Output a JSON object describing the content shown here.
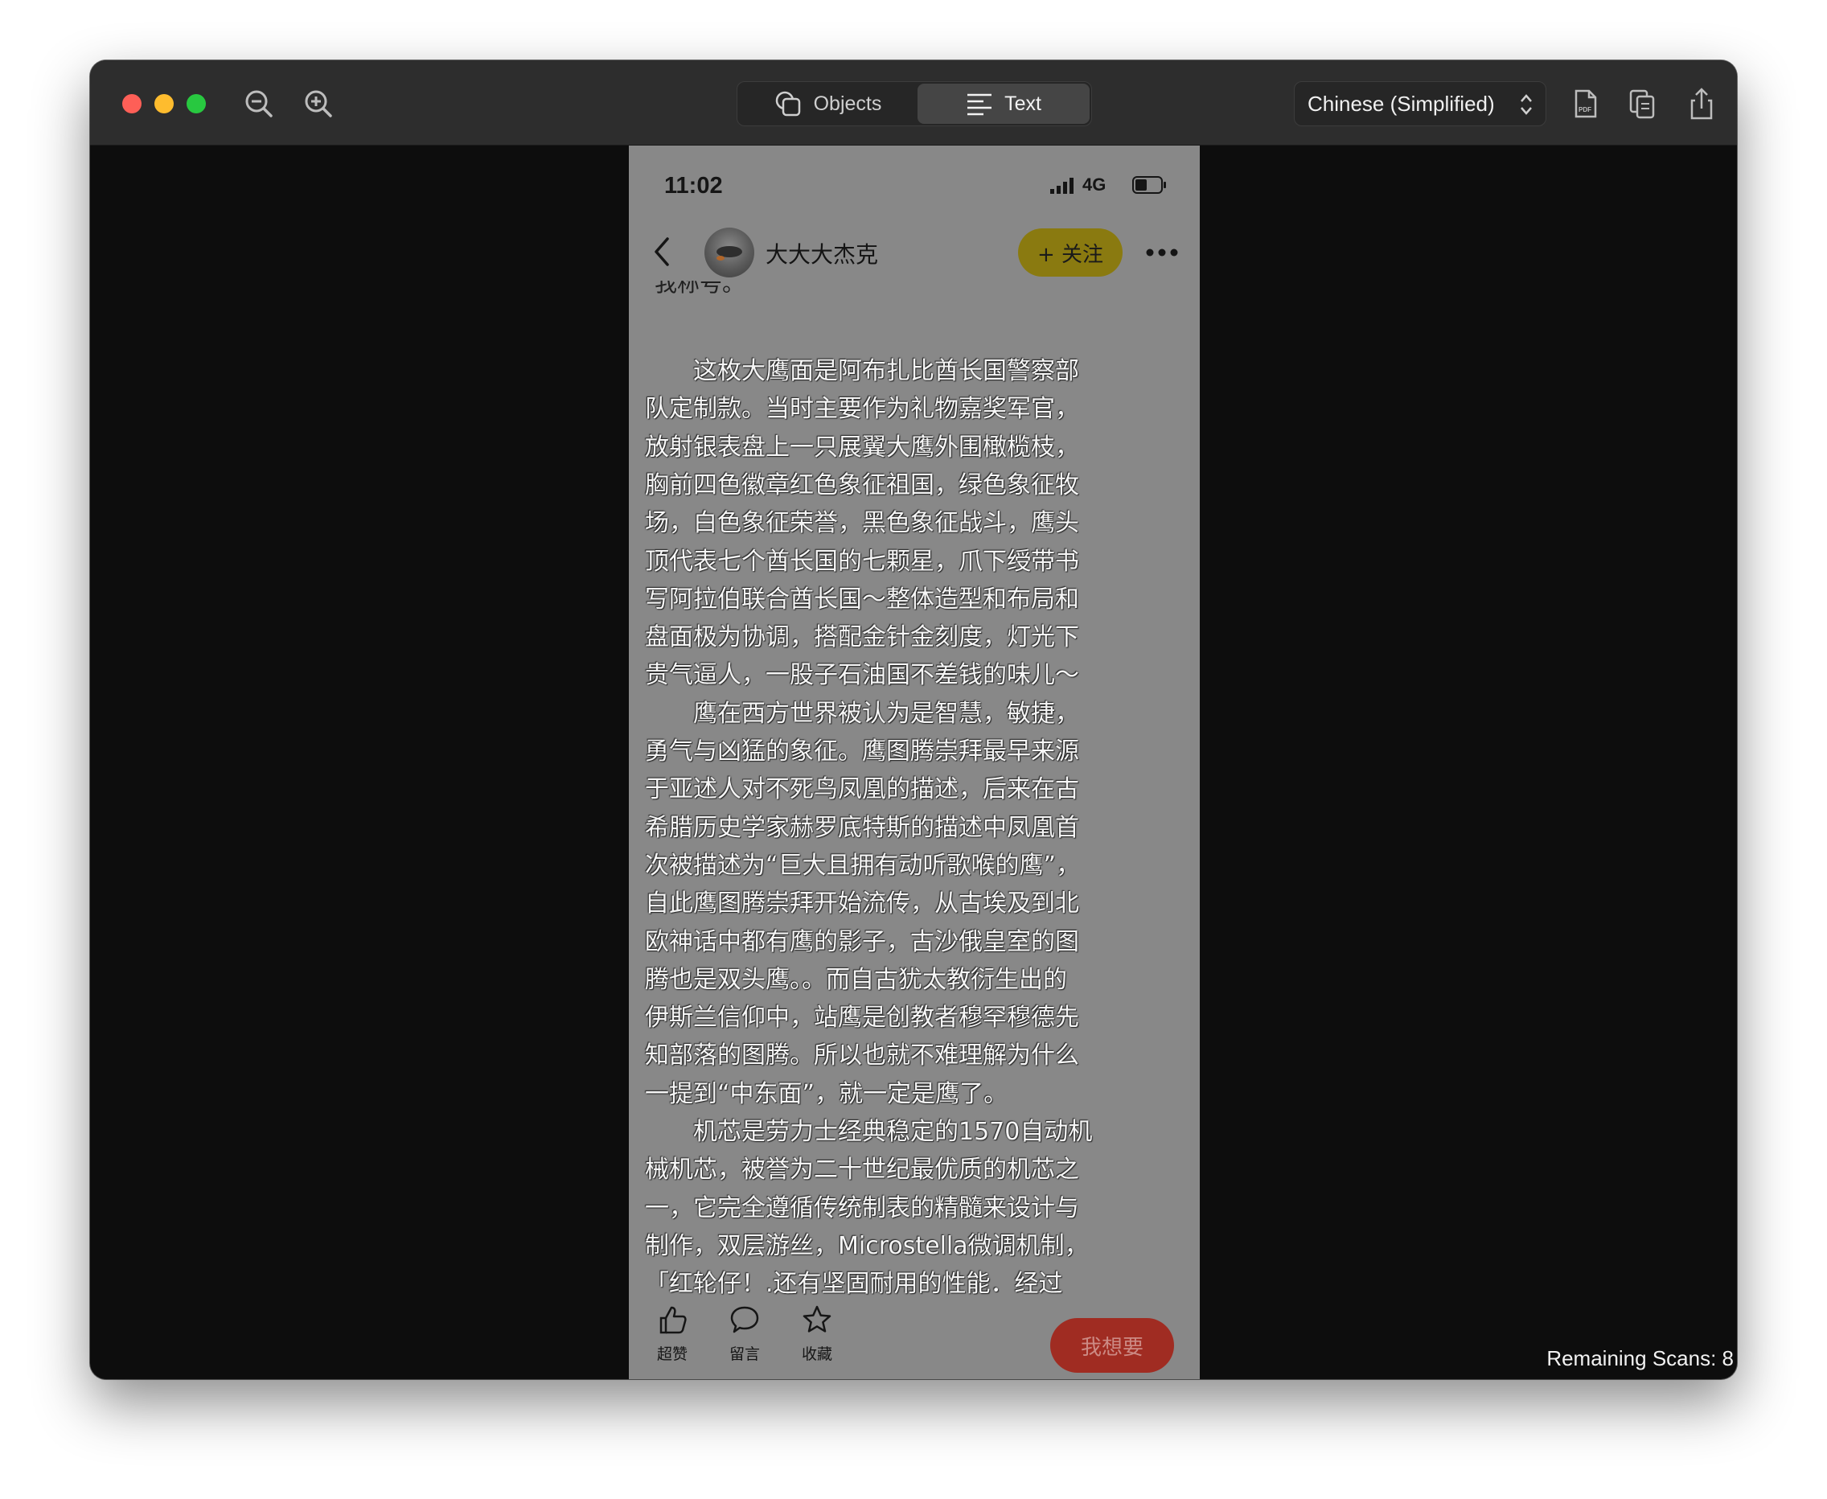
{
  "toolbar": {
    "segments": [
      {
        "label": "Objects",
        "icon": "objects-icon",
        "selected": false
      },
      {
        "label": "Text",
        "icon": "text-lines-icon",
        "selected": true
      }
    ],
    "language": "Chinese (Simplified)",
    "icons": [
      "zoom-out-icon",
      "zoom-in-icon",
      "pdf-export-icon",
      "copy-icon",
      "share-icon"
    ]
  },
  "phone": {
    "status": {
      "time": "11:02",
      "network": "4G"
    },
    "header": {
      "username": "大大大杰克",
      "follow_label": "+ 关注"
    },
    "fragment": "我称号。",
    "text_lines": [
      "　　这枚大鹰面是阿布扎比酋长国警察部",
      "队定制款。当时主要作为礼物嘉奖军官，",
      "放射银表盘上一只展翼大鹰外围橄榄枝，",
      "胸前四色徽章红色象征祖国，绿色象征牧",
      "场，白色象征荣誉，黑色象征战斗，鹰头",
      "顶代表七个酋长国的七颗星，爪下绶带书",
      "写阿拉伯联合酋长国～整体造型和布局和",
      "盘面极为协调，搭配金针金刻度，灯光下",
      "贵气逼人，一股子石油国不差钱的味儿～",
      "　　鹰在西方世界被认为是智慧，敏捷，",
      "勇气与凶猛的象征。鹰图腾崇拜最早来源",
      "于亚述人对不死鸟凤凰的描述，后来在古",
      "希腊历史学家赫罗底特斯的描述中凤凰首",
      "次被描述为“巨大且拥有动听歌喉的鹰”，",
      "自此鹰图腾崇拜开始流传，从古埃及到北",
      "欧神话中都有鹰的影子，古沙俄皇室的图",
      "腾也是双头鹰。。而自古犹太教衍生出的",
      "伊斯兰信仰中，站鹰是创教者穆罕穆德先",
      "知部落的图腾。所以也就不难理解为什么",
      "一提到“中东面”，就一定是鹰了。",
      "　　机芯是劳力士经典稳定的1570自动机",
      "械机芯，被誉为二十世纪最优质的机芯之",
      "一，它完全遵循传统制表的精髓来设计与",
      "制作，双层游丝，Microstella微调机制，",
      "「红轮仔！.还有坚固耐用的性能．经过"
    ],
    "actions": [
      {
        "label": "超赞",
        "icon": "thumbs-up-icon"
      },
      {
        "label": "留言",
        "icon": "comment-icon"
      },
      {
        "label": "收藏",
        "icon": "star-icon"
      }
    ],
    "want_label": "我想要"
  },
  "footer": {
    "remaining": "Remaining Scans: 8"
  }
}
